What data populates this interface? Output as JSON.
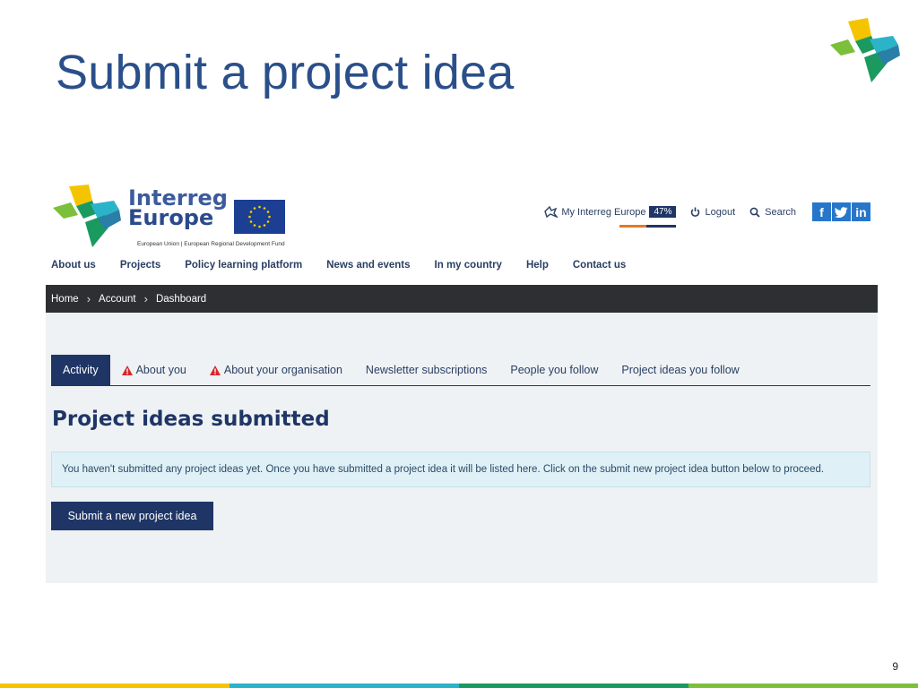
{
  "slide": {
    "title": "Submit a project idea",
    "page_number": "9"
  },
  "brand": {
    "name_line1": "Interreg",
    "name_line2": "Europe",
    "subtitle": "European Union | European Regional Development Fund"
  },
  "utility": {
    "my_interreg": "My Interreg Europe",
    "progress_label": "47%",
    "progress_value": 0.47,
    "logout": "Logout",
    "search": "Search"
  },
  "social": [
    "f",
    "t",
    "in"
  ],
  "nav": {
    "items": [
      "About us",
      "Projects",
      "Policy learning platform",
      "News and events",
      "In my country",
      "Help",
      "Contact us"
    ]
  },
  "breadcrumb": {
    "items": [
      "Home",
      "Account",
      "Dashboard"
    ]
  },
  "tabs": [
    {
      "label": "Activity",
      "active": true,
      "warning": false
    },
    {
      "label": "About you",
      "active": false,
      "warning": true
    },
    {
      "label": "About your organisation",
      "active": false,
      "warning": true
    },
    {
      "label": "Newsletter subscriptions",
      "active": false,
      "warning": false
    },
    {
      "label": "People you follow",
      "active": false,
      "warning": false
    },
    {
      "label": "Project ideas you follow",
      "active": false,
      "warning": false
    }
  ],
  "main": {
    "section_title": "Project ideas submitted",
    "info_message": "You haven't submitted any project ideas yet. Once you have submitted a project idea it will be listed here. Click on the submit new project idea button below to proceed.",
    "submit_button": "Submit a new project idea"
  },
  "colors": {
    "navy": "#1f3566",
    "title_blue": "#2a4f8a",
    "orange": "#e8781e",
    "stripe": [
      "#f5c400",
      "#2bb3c9",
      "#1a9a5f",
      "#7cbf3a"
    ]
  }
}
